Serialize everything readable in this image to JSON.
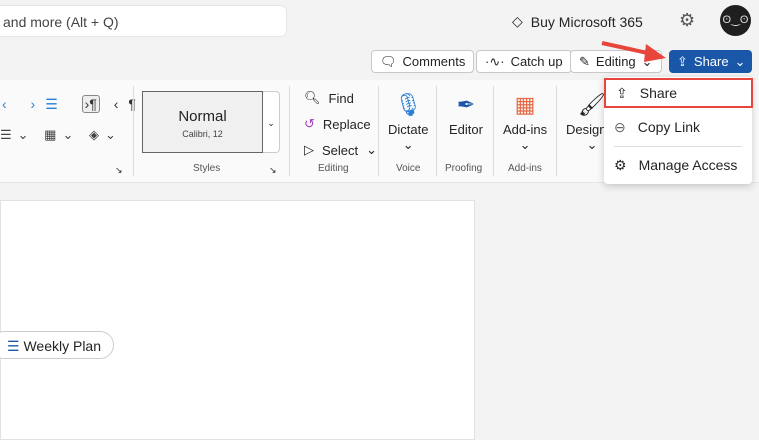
{
  "search": {
    "placeholder": "and more (Alt + Q)"
  },
  "header": {
    "buy_label": "Buy Microsoft 365",
    "avatar": "ʘ‿ʘ"
  },
  "toolbar": {
    "comments": "Comments",
    "catch_up": "Catch up",
    "editing": "Editing",
    "share": "Share"
  },
  "ribbon": {
    "styles": {
      "name": "Normal",
      "font": "Calibri, 12",
      "label": "Styles"
    },
    "editing": {
      "find": "Find",
      "replace": "Replace",
      "select": "Select",
      "label": "Editing"
    },
    "voice": {
      "button": "Dictate",
      "label": "Voice"
    },
    "proofing": {
      "button": "Editor",
      "label": "Proofing"
    },
    "addins": {
      "button": "Add-ins",
      "label": "Add-ins"
    },
    "designer": {
      "button": "Designer"
    }
  },
  "share_menu": {
    "items": [
      {
        "label": "Share",
        "icon": "share-icon"
      },
      {
        "label": "Copy Link",
        "icon": "link-icon"
      },
      {
        "label": "Manage Access",
        "icon": "gear-icon"
      }
    ]
  },
  "document": {
    "chip": "Weekly Plan"
  },
  "colors": {
    "share": "#1a57a8",
    "highlight": "#e8453c"
  }
}
